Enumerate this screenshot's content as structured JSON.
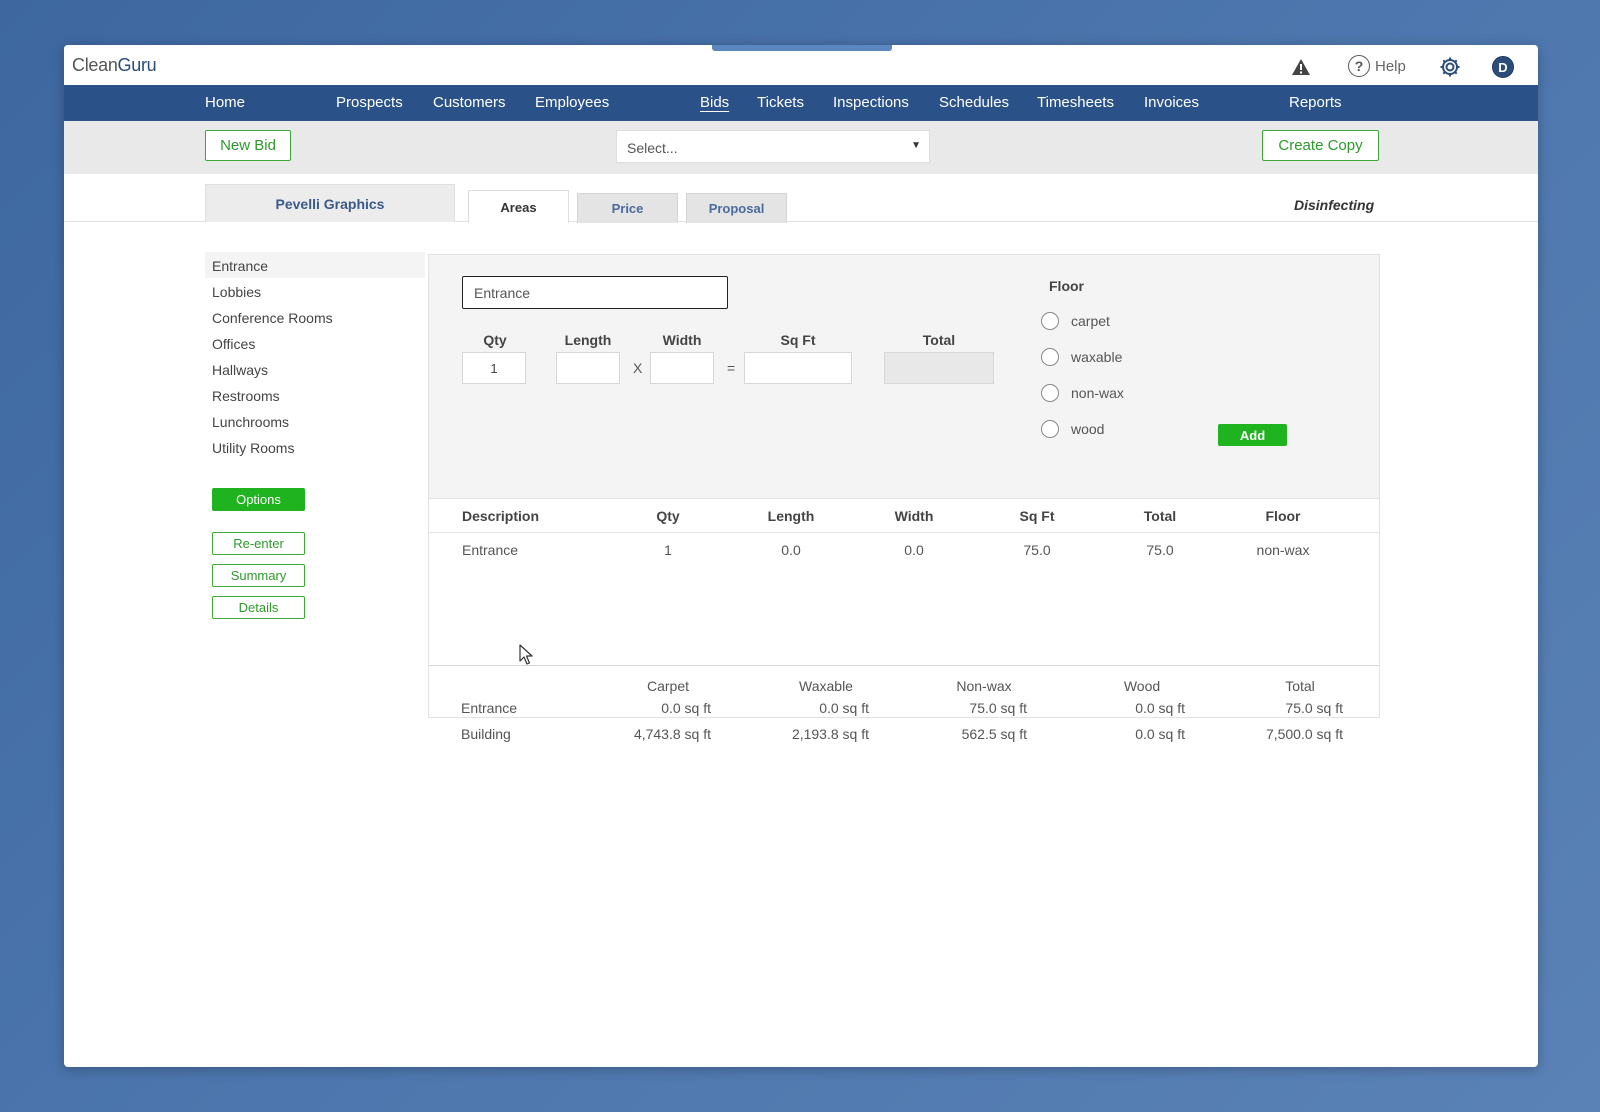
{
  "app": {
    "logo_part1": "Clean",
    "logo_part2": "Guru",
    "help_label": "Help",
    "avatar_initial": "D"
  },
  "nav": {
    "home": "Home",
    "prospects": "Prospects",
    "customers": "Customers",
    "employees": "Employees",
    "bids": "Bids",
    "tickets": "Tickets",
    "inspections": "Inspections",
    "schedules": "Schedules",
    "timesheets": "Timesheets",
    "invoices": "Invoices",
    "reports": "Reports"
  },
  "toolbar": {
    "new_bid": "New Bid",
    "select_placeholder": "Select...",
    "create_copy": "Create Copy"
  },
  "tabs": {
    "client": "Pevelli Graphics",
    "areas": "Areas",
    "price": "Price",
    "proposal": "Proposal",
    "service_type": "Disinfecting"
  },
  "sidebar": {
    "items": [
      "Entrance",
      "Lobbies",
      "Conference Rooms",
      "Offices",
      "Hallways",
      "Restrooms",
      "Lunchrooms",
      "Utility Rooms"
    ],
    "options": "Options",
    "reenter": "Re-enter",
    "summary": "Summary",
    "details": "Details"
  },
  "form": {
    "area_name": "Entrance",
    "qty_label": "Qty",
    "length_label": "Length",
    "width_label": "Width",
    "sqft_label": "Sq Ft",
    "total_label": "Total",
    "qty_value": "1",
    "times": "X",
    "equals": "=",
    "floor_label": "Floor",
    "floor_options": [
      "carpet",
      "waxable",
      "non-wax",
      "wood"
    ],
    "add": "Add"
  },
  "table": {
    "headers": {
      "description": "Description",
      "qty": "Qty",
      "length": "Length",
      "width": "Width",
      "sqft": "Sq Ft",
      "total": "Total",
      "floor": "Floor"
    },
    "rows": [
      {
        "description": "Entrance",
        "qty": "1",
        "length": "0.0",
        "width": "0.0",
        "sqft": "75.0",
        "total": "75.0",
        "floor": "non-wax"
      }
    ]
  },
  "summary": {
    "headers": {
      "carpet": "Carpet",
      "waxable": "Waxable",
      "nonwax": "Non-wax",
      "wood": "Wood",
      "total": "Total"
    },
    "area": {
      "label": "Entrance",
      "carpet": "0.0 sq ft",
      "waxable": "0.0 sq ft",
      "nonwax": "75.0 sq ft",
      "wood": "0.0 sq ft",
      "total": "75.0 sq ft"
    },
    "building": {
      "label": "Building",
      "carpet": "4,743.8 sq ft",
      "waxable": "2,193.8 sq ft",
      "nonwax": "562.5 sq ft",
      "wood": "0.0 sq ft",
      "total": "7,500.0 sq ft"
    }
  }
}
